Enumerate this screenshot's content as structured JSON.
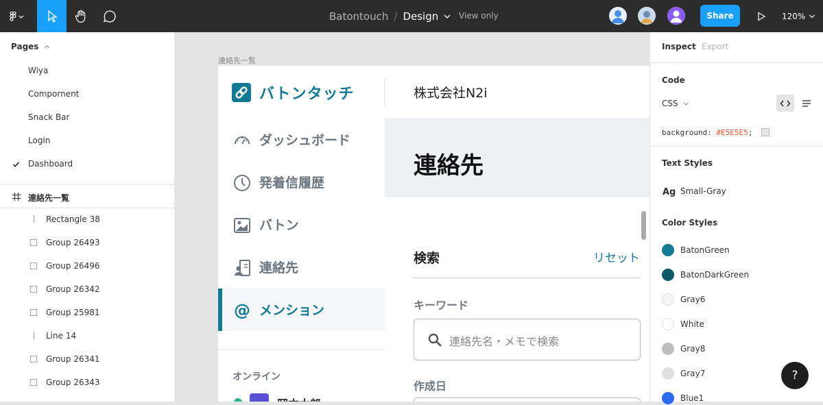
{
  "toolbar": {
    "project": "Batontouch",
    "separator": "/",
    "page": "Design",
    "view_only": "View only",
    "share_label": "Share",
    "zoom": "120%"
  },
  "pages_panel": {
    "header": "Pages",
    "pages": [
      "Wiya",
      "Compornent",
      "Snack Bar",
      "Login",
      "Dashboard"
    ],
    "selected_page": "Dashboard"
  },
  "layers": {
    "frame": "連絡先一覧",
    "items": [
      {
        "label": "Rectangle 38",
        "icon": "line-icon"
      },
      {
        "label": "Group 26493",
        "icon": "group-icon"
      },
      {
        "label": "Group 26496",
        "icon": "group-icon"
      },
      {
        "label": "Group 26342",
        "icon": "group-icon"
      },
      {
        "label": "Group 25981",
        "icon": "group-icon"
      },
      {
        "label": "Line 14",
        "icon": "line-icon"
      },
      {
        "label": "Group 26341",
        "icon": "group-icon"
      },
      {
        "label": "Group 26343",
        "icon": "group-icon"
      }
    ]
  },
  "canvas": {
    "frame_caption": "連絡先一覧",
    "app": {
      "app_name": "バトンタッチ",
      "company": "株式会社N2i",
      "nav": [
        {
          "label": "ダッシュボード",
          "icon": "speedometer-icon"
        },
        {
          "label": "発着信履歴",
          "icon": "clock-icon"
        },
        {
          "label": "バトン",
          "icon": "image-icon"
        },
        {
          "label": "連絡先",
          "icon": "contact-icon"
        },
        {
          "label": "メンション",
          "icon": "at-icon"
        }
      ],
      "active_nav": "メンション",
      "online_label": "オンライン",
      "online_user": "岡本太郎",
      "page_title": "連絡先",
      "search_heading": "検索",
      "reset_label": "リセット",
      "keyword_label": "キーワード",
      "keyword_placeholder": "連絡先名・メモで検索",
      "created_label": "作成日"
    }
  },
  "inspect_panel": {
    "tab_inspect": "Inspect",
    "tab_export": "Export",
    "code_heading": "Code",
    "language": "CSS",
    "css_property": "background:",
    "css_value": "#E5E5E5",
    "css_end": ";",
    "text_styles_heading": "Text Styles",
    "text_style_icon": "Ag",
    "text_style": "Small-Gray",
    "color_styles_heading": "Color Styles",
    "colors": [
      {
        "name": "BatonGreen",
        "hex": "#137a94"
      },
      {
        "name": "BatonDarkGreen",
        "hex": "#0d5968"
      },
      {
        "name": "Gray6",
        "hex": "#f5f5f5"
      },
      {
        "name": "White",
        "hex": "#ffffff"
      },
      {
        "name": "Gray8",
        "hex": "#bdbdbd"
      },
      {
        "name": "Gray7",
        "hex": "#e0e0e0"
      },
      {
        "name": "Blue1",
        "hex": "#2f6bf0"
      }
    ]
  },
  "help_label": "?"
}
